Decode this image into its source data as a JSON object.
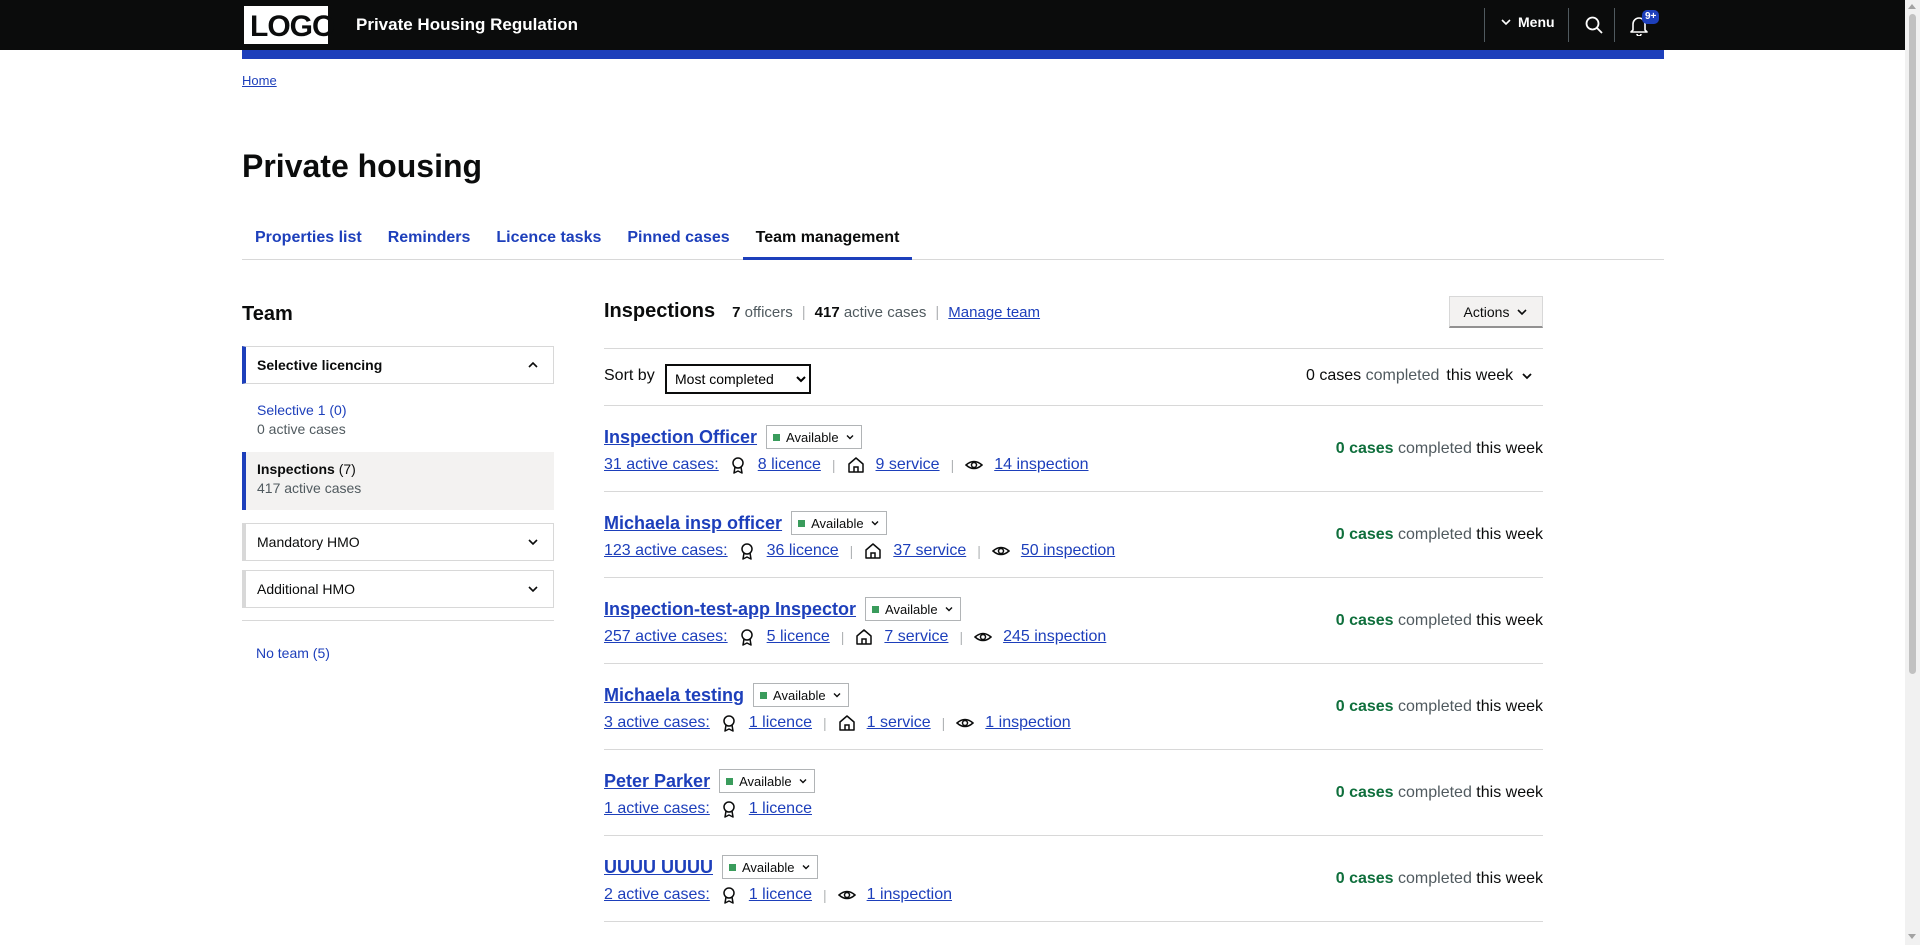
{
  "header": {
    "logo": "LOGO",
    "title": "Private Housing Regulation",
    "menu_label": "Menu",
    "notification_badge": "9+"
  },
  "breadcrumb": {
    "home": "Home"
  },
  "page_title": "Private housing",
  "tabs": [
    {
      "label": "Properties list",
      "active": false
    },
    {
      "label": "Reminders",
      "active": false
    },
    {
      "label": "Licence tasks",
      "active": false
    },
    {
      "label": "Pinned cases",
      "active": false
    },
    {
      "label": "Team management",
      "active": true
    }
  ],
  "sidebar": {
    "heading": "Team",
    "selective_group": {
      "label": "Selective licencing",
      "items": [
        {
          "name": "Selective 1 (0)",
          "meta": "0 active cases"
        },
        {
          "name": "Inspections",
          "count": "(7)",
          "meta": "417 active cases"
        }
      ]
    },
    "mandatory": "Mandatory HMO",
    "additional": "Additional HMO",
    "no_team": "No team (5)"
  },
  "panel": {
    "title": "Inspections",
    "officers_count": "7",
    "officers_label": "officers",
    "cases_count": "417",
    "cases_label": "active cases",
    "manage_link": "Manage team",
    "actions_label": "Actions",
    "sort_label": "Sort by",
    "sort_value": "Most completed",
    "summary_count": "0 cases",
    "summary_label": "completed",
    "summary_period": "this week"
  },
  "officers": [
    {
      "name": "Inspection Officer",
      "status": "Available",
      "active": "31 active cases:",
      "licence": "8 licence",
      "service": "9 service",
      "inspection": "14 inspection",
      "completed_num": "0 cases",
      "completed_label": "completed",
      "completed_period": "this week"
    },
    {
      "name": "Michaela insp officer",
      "status": "Available",
      "active": "123 active cases:",
      "licence": "36 licence",
      "service": "37 service",
      "inspection": "50 inspection",
      "completed_num": "0 cases",
      "completed_label": "completed",
      "completed_period": "this week"
    },
    {
      "name": "Inspection-test-app Inspector",
      "status": "Available",
      "active": "257 active cases:",
      "licence": "5 licence",
      "service": "7 service",
      "inspection": "245 inspection",
      "completed_num": "0 cases",
      "completed_label": "completed",
      "completed_period": "this week"
    },
    {
      "name": "Michaela testing",
      "status": "Available",
      "active": "3 active cases:",
      "licence": "1 licence",
      "service": "1 service",
      "inspection": "1 inspection",
      "completed_num": "0 cases",
      "completed_label": "completed",
      "completed_period": "this week"
    },
    {
      "name": "Peter Parker",
      "status": "Available",
      "active": "1 active cases:",
      "licence": "1 licence",
      "completed_num": "0 cases",
      "completed_label": "completed",
      "completed_period": "this week"
    },
    {
      "name": "UUUU UUUU",
      "status": "Available",
      "active": "2 active cases:",
      "licence": "1 licence",
      "inspection": "1 inspection",
      "completed_num": "0 cases",
      "completed_label": "completed",
      "completed_period": "this week"
    }
  ],
  "colors": {
    "brand_blue": "#1d3fbb",
    "header_bg": "#0b0c0c",
    "available_green": "#3a9c5c",
    "completed_green": "#0f6f3c"
  }
}
